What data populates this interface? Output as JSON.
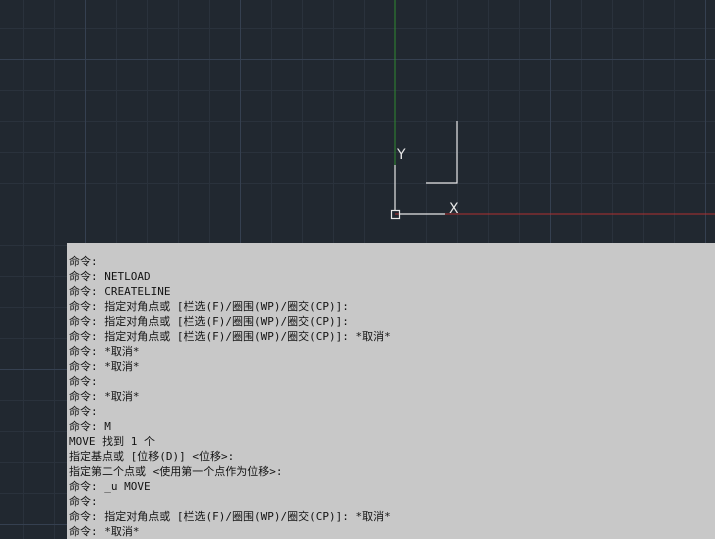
{
  "ucs": {
    "y_axis_label": "Y",
    "x_axis_label": "X"
  },
  "colors": {
    "canvas_background": "#212830",
    "grid_minor": "#2a323c",
    "grid_major": "#354050",
    "x_axis": "#b03030",
    "y_axis": "#2f8a2f",
    "ucs_icon": "#e6e6e6",
    "command_history_background": "#c8c8c8",
    "command_history_text": "#141414"
  },
  "command_history": {
    "lines": [
      "命令:",
      "命令: NETLOAD",
      "命令: CREATELINE",
      "命令: 指定对角点或 [栏选(F)/圈围(WP)/圈交(CP)]:",
      "命令: 指定对角点或 [栏选(F)/圈围(WP)/圈交(CP)]:",
      "命令: 指定对角点或 [栏选(F)/圈围(WP)/圈交(CP)]: *取消*",
      "命令: *取消*",
      "命令: *取消*",
      "命令:",
      "命令: *取消*",
      "命令:",
      "命令: M",
      "MOVE 找到 1 个",
      "指定基点或 [位移(D)] <位移>:",
      "指定第二个点或 <使用第一个点作为位移>:",
      "命令: _u MOVE",
      "命令:",
      "命令: 指定对角点或 [栏选(F)/圈围(WP)/圈交(CP)]: *取消*",
      "命令: *取消*"
    ]
  }
}
